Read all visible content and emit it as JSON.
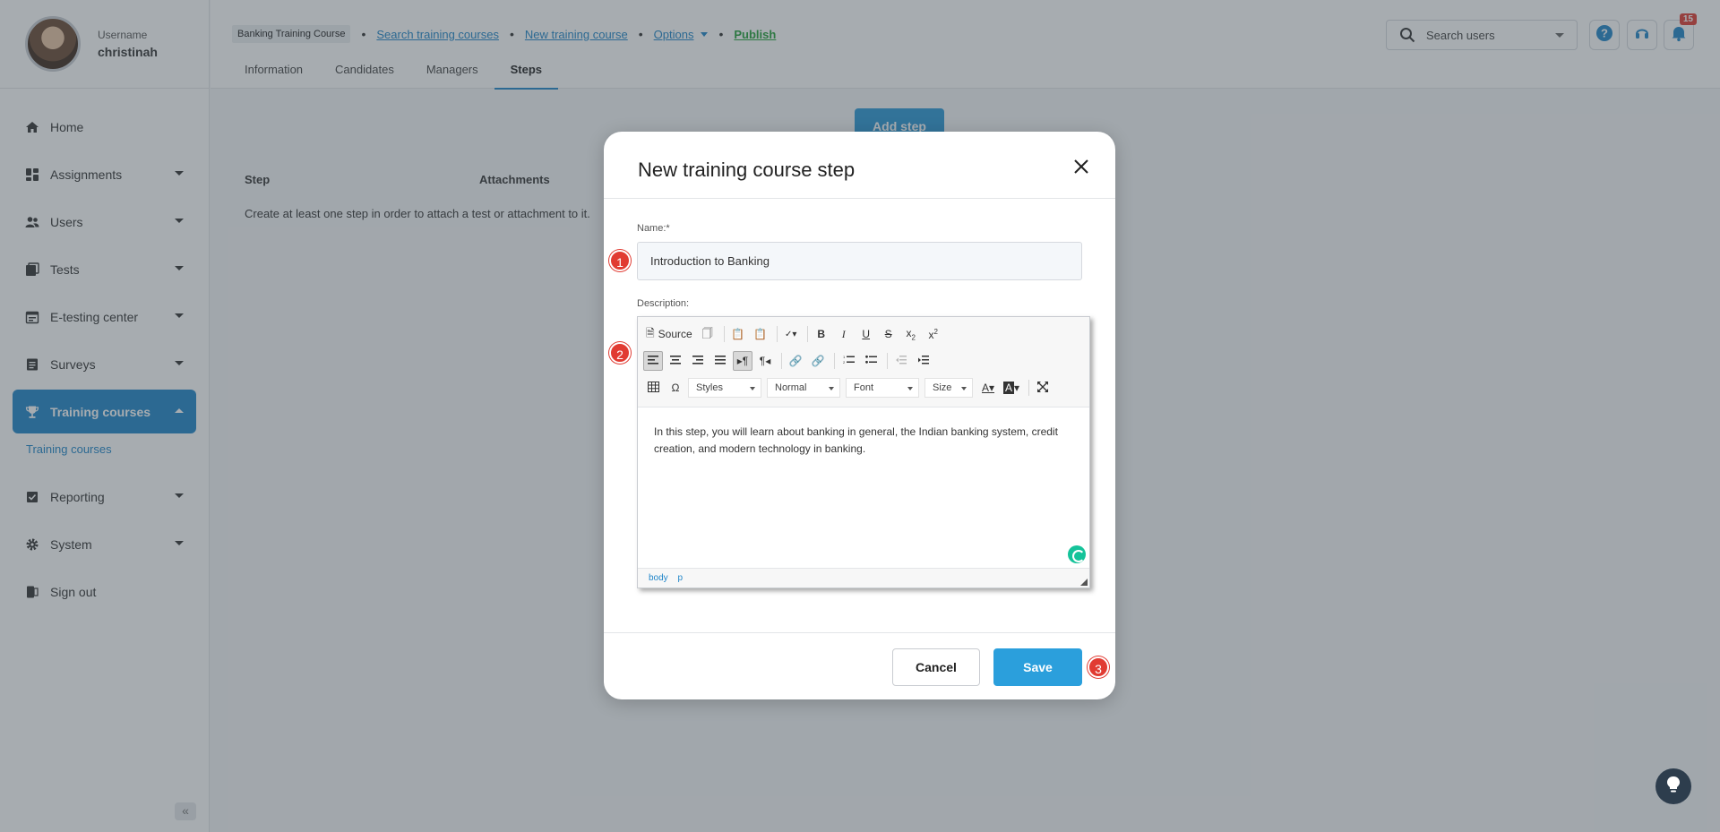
{
  "profile": {
    "label": "Username",
    "name": "christinah"
  },
  "sidebar": {
    "items": [
      {
        "label": "Home",
        "icon": "home-icon"
      },
      {
        "label": "Assignments",
        "icon": "dashboard-icon"
      },
      {
        "label": "Users",
        "icon": "users-icon"
      },
      {
        "label": "Tests",
        "icon": "tests-icon"
      },
      {
        "label": "E-testing center",
        "icon": "calendar-icon"
      },
      {
        "label": "Surveys",
        "icon": "survey-icon"
      },
      {
        "label": "Training courses",
        "icon": "trophy-icon",
        "sub": "Training courses"
      },
      {
        "label": "Reporting",
        "icon": "report-icon"
      },
      {
        "label": "System",
        "icon": "gear-icon"
      },
      {
        "label": "Sign out",
        "icon": "signout-icon"
      }
    ],
    "collapse": "«"
  },
  "header": {
    "course_tag": "Banking Training Course",
    "crumb_search": "Search training courses",
    "crumb_new": "New training course",
    "crumb_options": "Options",
    "crumb_publish": "Publish",
    "tabs": [
      "Information",
      "Candidates",
      "Managers",
      "Steps"
    ],
    "active_tab": "Steps",
    "search_placeholder": "Search users",
    "notification_count": "15"
  },
  "main": {
    "add_step": "Add step",
    "col_step": "Step",
    "col_attachments": "Attachments",
    "empty_message": "Create at least one step in order to attach a test or attachment to it."
  },
  "modal": {
    "title": "New training course step",
    "name_label": "Name:*",
    "name_value": "Introduction to Banking",
    "description_label": "Description:",
    "toolbar": {
      "source": "Source",
      "styles": "Styles",
      "format": "Normal",
      "font": "Font",
      "size": "Size"
    },
    "description_text": "In this step, you will learn about banking in general, the Indian banking system, credit creation, and modern technology in banking.",
    "path": [
      "body",
      "p"
    ],
    "cancel": "Cancel",
    "save": "Save",
    "badges": [
      "1",
      "2",
      "3"
    ]
  },
  "colors": {
    "accent": "#1f85c9",
    "publish": "#23a03a",
    "badge": "#e13b32"
  }
}
